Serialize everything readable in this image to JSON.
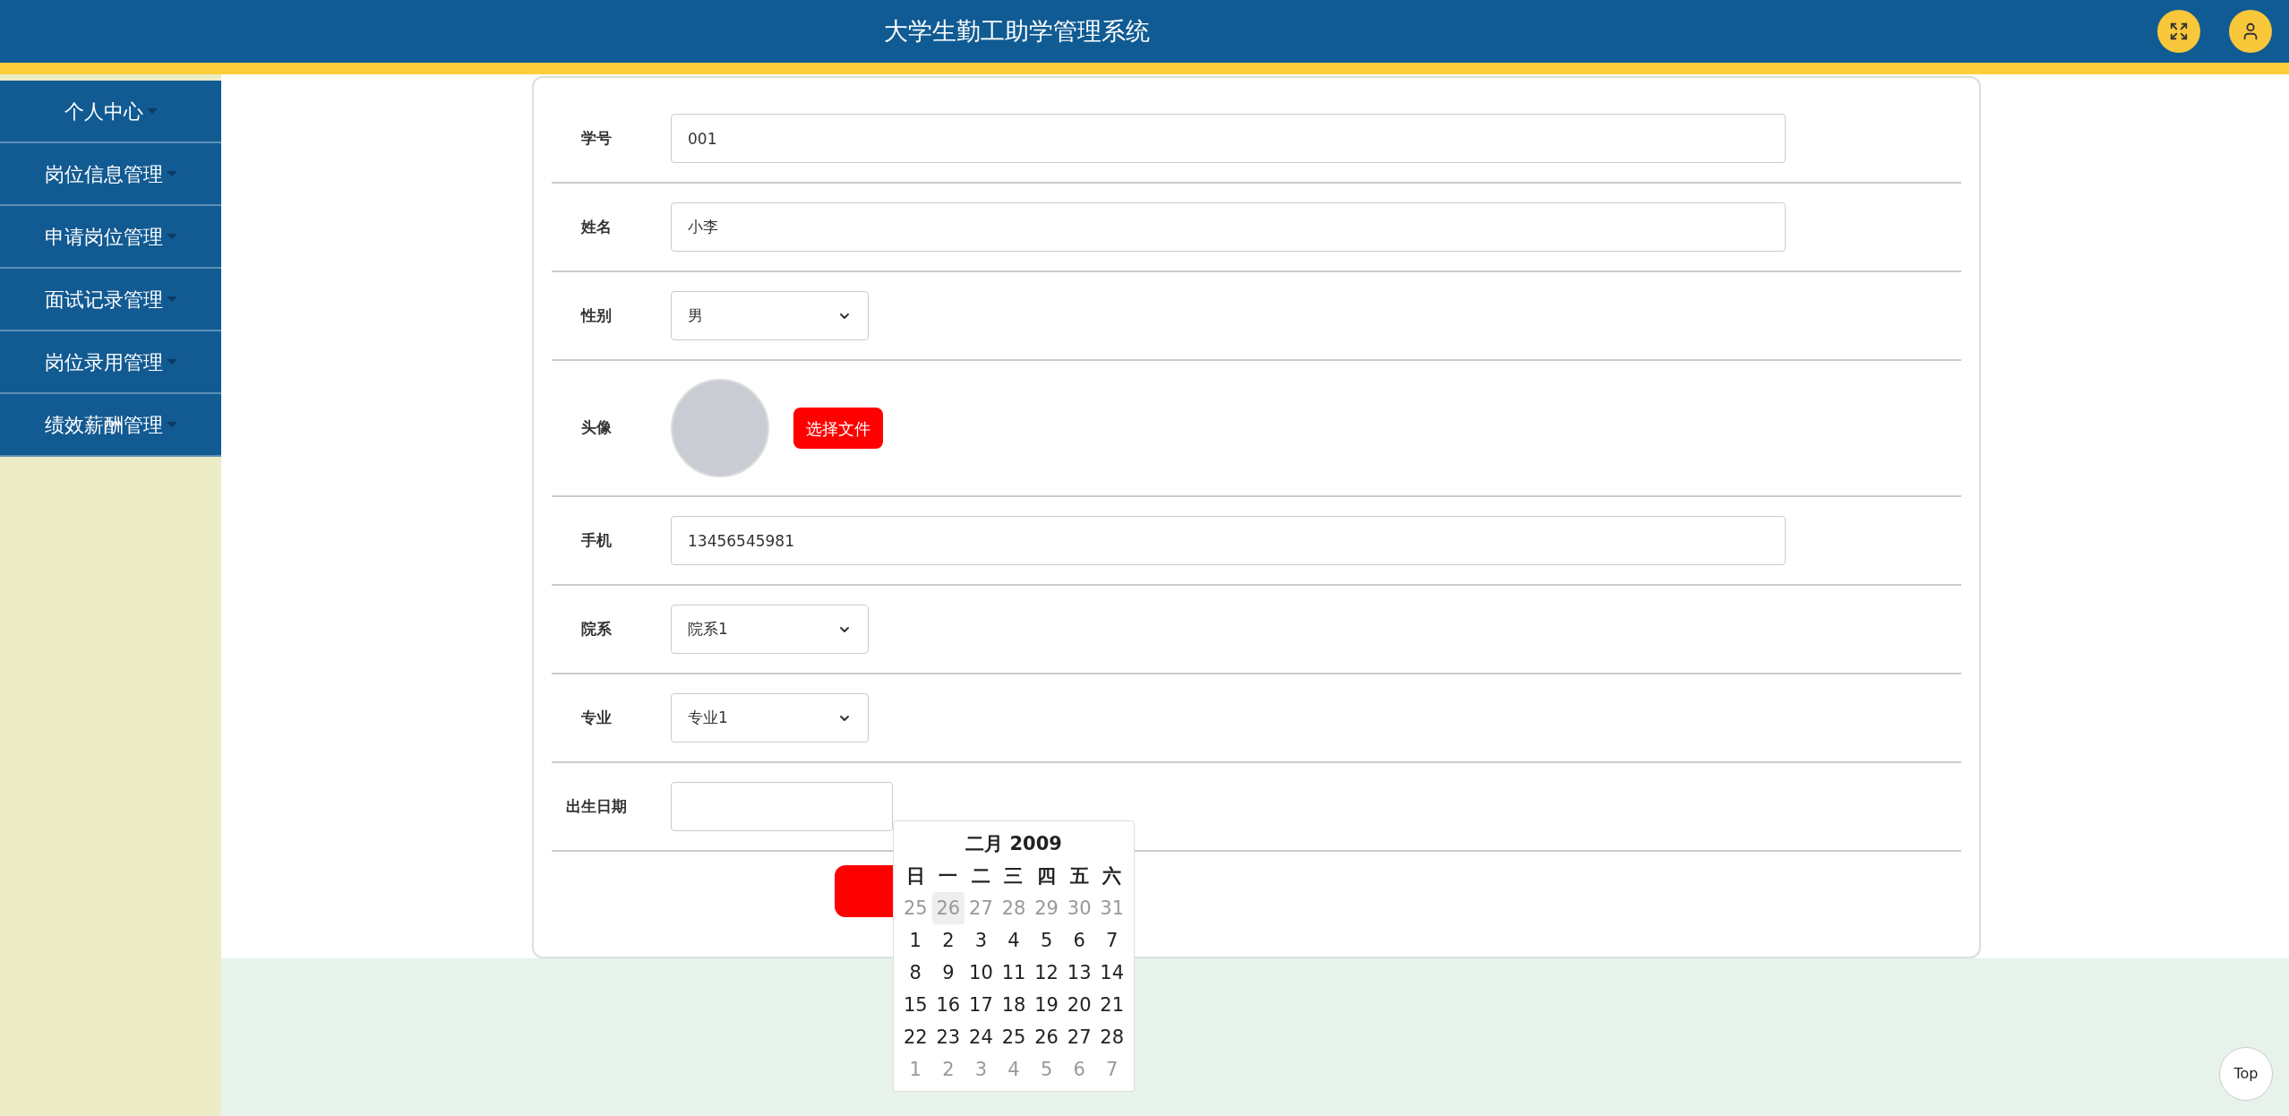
{
  "header": {
    "title": "大学生勤工助学管理系统"
  },
  "sidebar": {
    "items": [
      {
        "label": "个人中心"
      },
      {
        "label": "岗位信息管理"
      },
      {
        "label": "申请岗位管理"
      },
      {
        "label": "面试记录管理"
      },
      {
        "label": "岗位录用管理"
      },
      {
        "label": "绩效薪酬管理"
      }
    ]
  },
  "form": {
    "rows": [
      {
        "kind": "text",
        "label": "学号",
        "value": "001"
      },
      {
        "kind": "text",
        "label": "姓名",
        "value": "小李"
      },
      {
        "kind": "select",
        "label": "性别",
        "value": "男"
      },
      {
        "kind": "avatar",
        "label": "头像",
        "button": "选择文件"
      },
      {
        "kind": "text",
        "label": "手机",
        "value": "13456545981"
      },
      {
        "kind": "select",
        "label": "院系",
        "value": "院系1"
      },
      {
        "kind": "select",
        "label": "专业",
        "value": "专业1"
      },
      {
        "kind": "date",
        "label": "出生日期"
      }
    ]
  },
  "datepicker": {
    "title": "二月 2009",
    "weekdays": [
      "日",
      "一",
      "二",
      "三",
      "四",
      "五",
      "六"
    ],
    "weeks": [
      [
        {
          "label": "25",
          "muted": true,
          "hovered": false
        },
        {
          "label": "26",
          "muted": true,
          "hovered": true
        },
        {
          "label": "27",
          "muted": true,
          "hovered": false
        },
        {
          "label": "28",
          "muted": true,
          "hovered": false
        },
        {
          "label": "29",
          "muted": true,
          "hovered": false
        },
        {
          "label": "30",
          "muted": true,
          "hovered": false
        },
        {
          "label": "31",
          "muted": true,
          "hovered": false
        }
      ],
      [
        {
          "label": "1",
          "muted": false,
          "hovered": false
        },
        {
          "label": "2",
          "muted": false,
          "hovered": false
        },
        {
          "label": "3",
          "muted": false,
          "hovered": false
        },
        {
          "label": "4",
          "muted": false,
          "hovered": false
        },
        {
          "label": "5",
          "muted": false,
          "hovered": false
        },
        {
          "label": "6",
          "muted": false,
          "hovered": false
        },
        {
          "label": "7",
          "muted": false,
          "hovered": false
        }
      ],
      [
        {
          "label": "8",
          "muted": false,
          "hovered": false
        },
        {
          "label": "9",
          "muted": false,
          "hovered": false
        },
        {
          "label": "10",
          "muted": false,
          "hovered": false
        },
        {
          "label": "11",
          "muted": false,
          "hovered": false
        },
        {
          "label": "12",
          "muted": false,
          "hovered": false
        },
        {
          "label": "13",
          "muted": false,
          "hovered": false
        },
        {
          "label": "14",
          "muted": false,
          "hovered": false
        }
      ],
      [
        {
          "label": "15",
          "muted": false,
          "hovered": false
        },
        {
          "label": "16",
          "muted": false,
          "hovered": false
        },
        {
          "label": "17",
          "muted": false,
          "hovered": false
        },
        {
          "label": "18",
          "muted": false,
          "hovered": false
        },
        {
          "label": "19",
          "muted": false,
          "hovered": false
        },
        {
          "label": "20",
          "muted": false,
          "hovered": false
        },
        {
          "label": "21",
          "muted": false,
          "hovered": false
        }
      ],
      [
        {
          "label": "22",
          "muted": false,
          "hovered": false
        },
        {
          "label": "23",
          "muted": false,
          "hovered": false
        },
        {
          "label": "24",
          "muted": false,
          "hovered": false
        },
        {
          "label": "25",
          "muted": false,
          "hovered": false
        },
        {
          "label": "26",
          "muted": false,
          "hovered": false
        },
        {
          "label": "27",
          "muted": false,
          "hovered": false
        },
        {
          "label": "28",
          "muted": false,
          "hovered": false
        }
      ],
      [
        {
          "label": "1",
          "muted": true,
          "hovered": false
        },
        {
          "label": "2",
          "muted": true,
          "hovered": false
        },
        {
          "label": "3",
          "muted": true,
          "hovered": false
        },
        {
          "label": "4",
          "muted": true,
          "hovered": false
        },
        {
          "label": "5",
          "muted": true,
          "hovered": false
        },
        {
          "label": "6",
          "muted": true,
          "hovered": false
        },
        {
          "label": "7",
          "muted": true,
          "hovered": false
        }
      ]
    ]
  },
  "back_to_top": {
    "label": "Top"
  }
}
